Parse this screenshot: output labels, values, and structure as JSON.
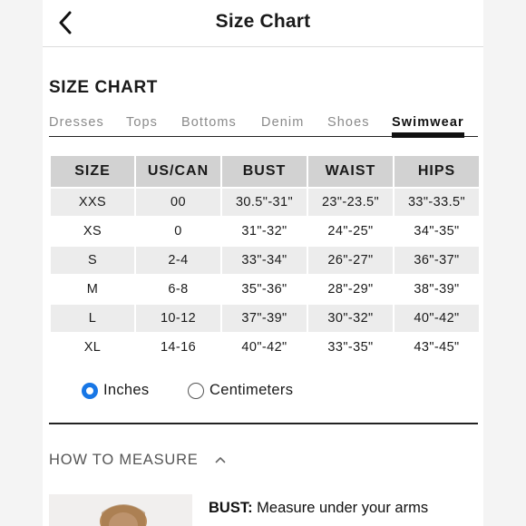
{
  "nav": {
    "title": "Size Chart",
    "back_icon": "chevron-left-icon"
  },
  "section_title": "SIZE CHART",
  "tabs": [
    {
      "label": "Dresses",
      "active": false
    },
    {
      "label": "Tops",
      "active": false
    },
    {
      "label": "Bottoms",
      "active": false
    },
    {
      "label": "Denim",
      "active": false
    },
    {
      "label": "Shoes",
      "active": false
    },
    {
      "label": "Swimwear",
      "active": true
    }
  ],
  "table": {
    "headers": [
      "SIZE",
      "US/CAN",
      "BUST",
      "WAIST",
      "HIPS"
    ],
    "rows": [
      [
        "XXS",
        "00",
        "30.5\"-31\"",
        "23\"-23.5\"",
        "33\"-33.5\""
      ],
      [
        "XS",
        "0",
        "31\"-32\"",
        "24\"-25\"",
        "34\"-35\""
      ],
      [
        "S",
        "2-4",
        "33\"-34\"",
        "26\"-27\"",
        "36\"-37\""
      ],
      [
        "M",
        "6-8",
        "35\"-36\"",
        "28\"-29\"",
        "38\"-39\""
      ],
      [
        "L",
        "10-12",
        "37\"-39\"",
        "30\"-32\"",
        "40\"-42\""
      ],
      [
        "XL",
        "14-16",
        "40\"-42\"",
        "33\"-35\"",
        "43\"-45\""
      ]
    ]
  },
  "units": {
    "inches_label": "Inches",
    "centimeters_label": "Centimeters",
    "selected": "Inches"
  },
  "how_to_measure": {
    "label": "HOW TO MEASURE",
    "bust_label": "BUST:",
    "bust_text": " Measure under your arms"
  },
  "colors": {
    "accent": "#1877e6",
    "header_bg": "#d2d2d2",
    "shaded_row": "#ececec"
  }
}
